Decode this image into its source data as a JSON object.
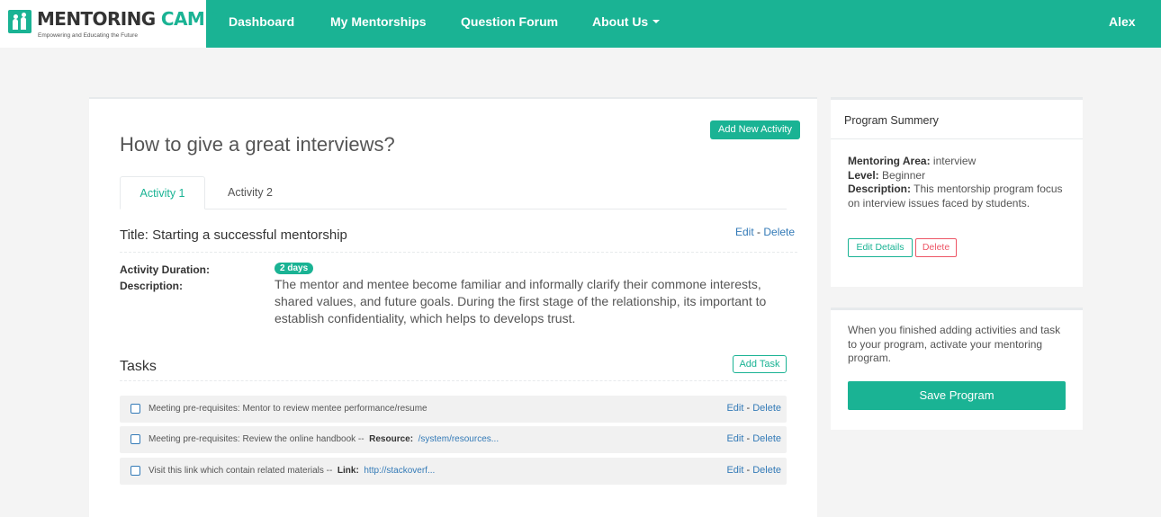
{
  "brand": {
    "name_part1": "MENTORING",
    "name_part2": "CAMPUS",
    "tagline": "Empowering and Educating the Future"
  },
  "nav": {
    "dashboard": "Dashboard",
    "my_mentorships": "My Mentorships",
    "question_forum": "Question Forum",
    "about_us": "About Us",
    "user": "Alex"
  },
  "program": {
    "title": "How to give a great interviews?",
    "add_activity_label": "Add New Activity",
    "tabs": [
      {
        "label": "Activity 1",
        "active": true
      },
      {
        "label": "Activity 2",
        "active": false
      }
    ]
  },
  "activity": {
    "title": "Title: Starting a successful mentorship",
    "edit_label": "Edit",
    "separator": " - ",
    "delete_label": "Delete",
    "duration_label": "Activity Duration:",
    "duration_value": "2 days",
    "description_label": "Description:",
    "description": "The mentor and mentee become familiar and informally clarify their commone interests, shared values, and future goals. During the first stage of the relationship, its important to establish confidentiality, which helps to develops trust."
  },
  "tasks": {
    "heading": "Tasks",
    "add_label": "Add Task",
    "items": [
      {
        "text": "Meeting pre-requisites: Mentor to review mentee performance/resume",
        "ref_label": "",
        "ref_value": "",
        "edit": "Edit",
        "sep": " - ",
        "delete": "Delete"
      },
      {
        "text": "Meeting pre-requisites: Review the online handbook --",
        "ref_label": "Resource",
        "ref_value": "/system/resources...",
        "edit": "Edit",
        "sep": " - ",
        "delete": "Delete"
      },
      {
        "text": "Visit this link which contain related materials --",
        "ref_label": "Link",
        "ref_value": "http://stackoverf...",
        "edit": "Edit",
        "sep": " - ",
        "delete": "Delete"
      }
    ]
  },
  "summary": {
    "title": "Program Summery",
    "area_label": "Mentoring Area:",
    "area_value": "interview",
    "level_label": "Level:",
    "level_value": "Beginner",
    "description_label": "Description:",
    "description_value": "This mentorship program focus on interview issues faced by students.",
    "edit_details_label": "Edit Details",
    "delete_label": "Delete"
  },
  "activate": {
    "text": "When you finished adding activities and task to your program, activate your mentoring program.",
    "save_label": "Save Program"
  },
  "colors": {
    "accent": "#1ab394",
    "link": "#337ab7",
    "danger": "#ed5565"
  }
}
